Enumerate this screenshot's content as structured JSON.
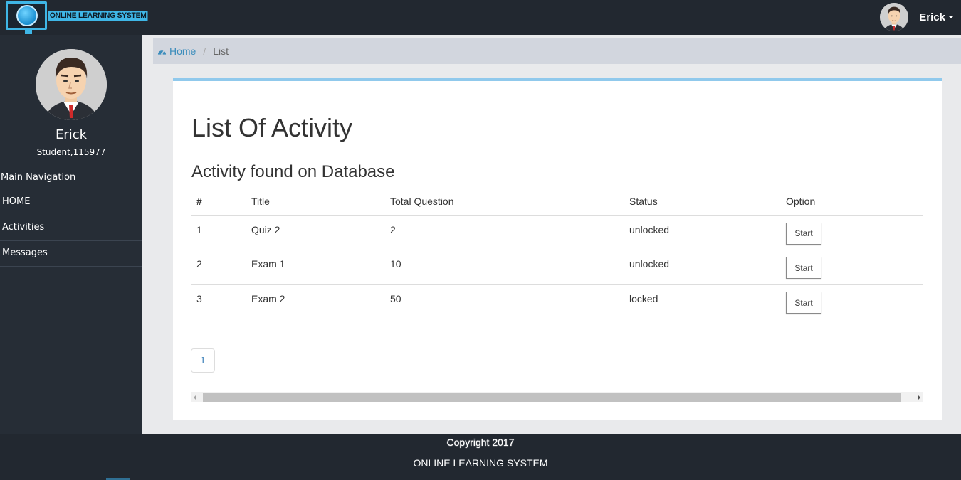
{
  "brand": {
    "logo_text": "ONLINE LEARNING SYSTEM"
  },
  "topbar": {
    "user_name": "Erick"
  },
  "sidebar": {
    "user_name": "Erick",
    "user_role": "Student,115977",
    "heading": "Main Navigation",
    "items": [
      {
        "label": "HOME"
      },
      {
        "label": "Activities"
      },
      {
        "label": "Messages"
      }
    ]
  },
  "breadcrumb": {
    "home": "Home",
    "separator": "/",
    "current": "List"
  },
  "main": {
    "title": "List Of Activity",
    "subtitle": "Activity found on Database",
    "table": {
      "headers": [
        "#",
        "Title",
        "Total Question",
        "Status",
        "Option"
      ],
      "rows": [
        {
          "num": "1",
          "title": "Quiz 2",
          "total": "2",
          "status": "unlocked",
          "option": "Start"
        },
        {
          "num": "2",
          "title": "Exam 1",
          "total": "10",
          "status": "unlocked",
          "option": "Start"
        },
        {
          "num": "3",
          "title": "Exam 2",
          "total": "50",
          "status": "locked",
          "option": "Start"
        }
      ]
    },
    "pagination": {
      "current_page": "1"
    }
  },
  "footer": {
    "copyright": "Copyright 2017",
    "name": "ONLINE LEARNING SYSTEM"
  },
  "colors": {
    "accent": "#3c8dbc",
    "logo": "#3fb6e6",
    "topbar": "#222830",
    "sidebar": "#262d36",
    "panel_border": "#90c9ec"
  }
}
